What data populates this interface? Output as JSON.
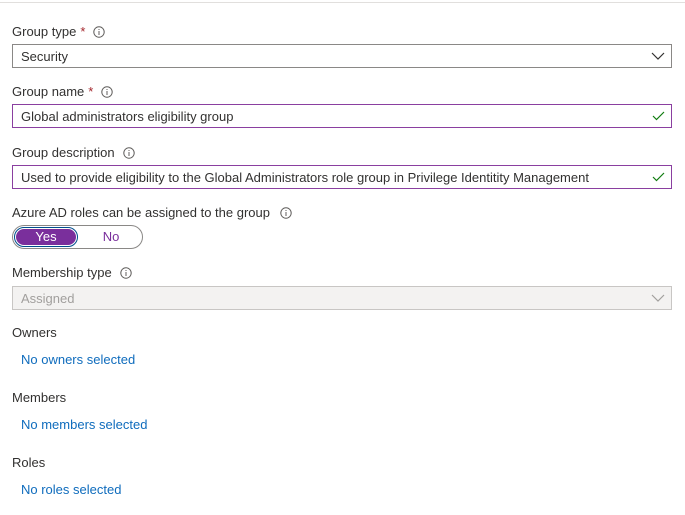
{
  "group_type": {
    "label": "Group type",
    "required": "*",
    "value": "Security"
  },
  "group_name": {
    "label": "Group name",
    "required": "*",
    "value": "Global administrators eligibility group"
  },
  "group_description": {
    "label": "Group description",
    "value": "Used to provide eligibility to the Global Administrators role group in Privilege Identitity Management"
  },
  "role_assignable": {
    "label": "Azure AD roles can be assigned to the group",
    "yes": "Yes",
    "no": "No",
    "selected": "Yes"
  },
  "membership_type": {
    "label": "Membership type",
    "value": "Assigned"
  },
  "owners": {
    "label": "Owners",
    "link": "No owners selected"
  },
  "members": {
    "label": "Members",
    "link": "No members selected"
  },
  "roles": {
    "label": "Roles",
    "link": "No roles selected"
  },
  "colors": {
    "accent": "#7a2f9c",
    "link": "#0f6cbd",
    "valid_check": "#107c10",
    "required": "#a4262c"
  },
  "icons": {
    "info": "info-icon",
    "dropdown": "chevron-down-icon",
    "valid": "checkmark-icon"
  }
}
